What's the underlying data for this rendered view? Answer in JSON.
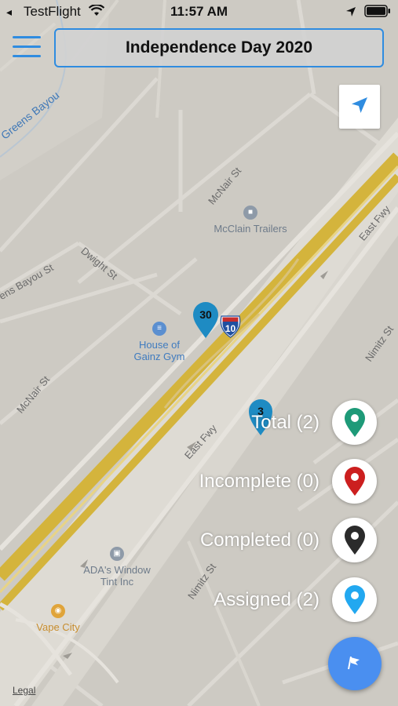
{
  "status_bar": {
    "back_glyph": "◂",
    "app_name": "TestFlight",
    "time": "11:57 AM"
  },
  "header": {
    "title": "Independence Day 2020"
  },
  "map": {
    "labels": {
      "greens_bayou": "Greens Bayou",
      "greens_bayou_st": "ens Bayou St",
      "mcnair_st_top": "McNair St",
      "mcnair_st_left": "McNair St",
      "dwight_st": "Dwight St",
      "east_fwy_right": "East Fwy",
      "east_fwy_center": "East Fwy",
      "nimitz_st_right": "Nimitz St",
      "nimitz_st_bottom": "Nimitz St",
      "interstate_shield": "10"
    },
    "pois": {
      "mcclain": "McClain Trailers",
      "gym_line1": "House of",
      "gym_line2": "Gainz Gym",
      "ada_line1": "ADA's Window",
      "ada_line2": "Tint Inc",
      "vape": "Vape City"
    },
    "markers": [
      {
        "count": "30",
        "color": "#1e8bc3"
      },
      {
        "count": "3",
        "color": "#1e8bc3"
      }
    ],
    "legal": "Legal"
  },
  "filters": [
    {
      "label": "Total (2)",
      "icon": "green-pin-icon",
      "color": "#1e9a78"
    },
    {
      "label": "Incomplete (0)",
      "icon": "red-pin-icon",
      "color": "#cc1f1f"
    },
    {
      "label": "Completed (0)",
      "icon": "black-pin-icon",
      "color": "#2b2b2b"
    },
    {
      "label": "Assigned (2)",
      "icon": "blue-pin-icon",
      "color": "#22a8f0"
    }
  ],
  "colors": {
    "accent": "#2f8ce0",
    "fab": "#4a8ff0",
    "freeway": "#d4b43c",
    "map_bg": "#cdcac3"
  }
}
